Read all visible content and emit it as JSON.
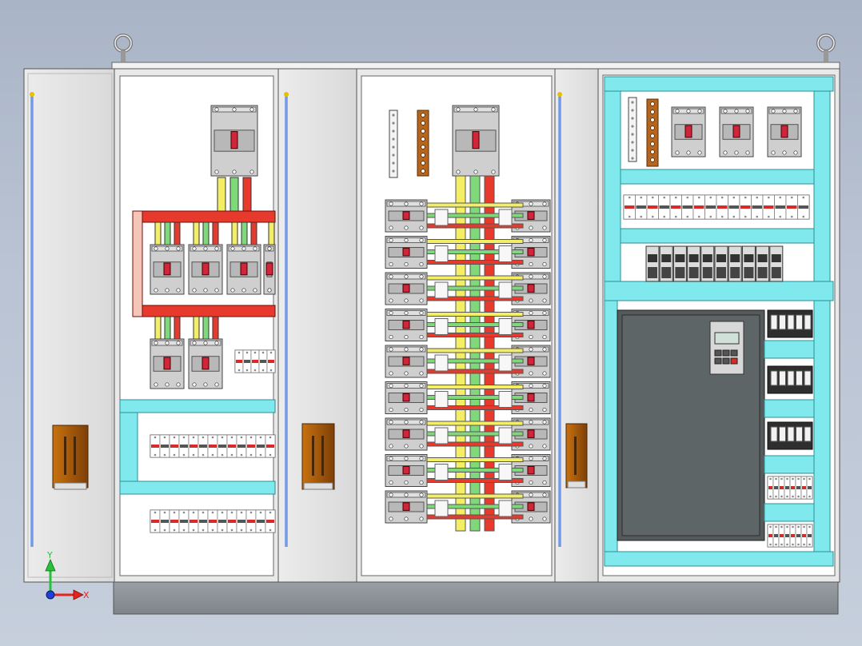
{
  "viewport": {
    "width": 1078,
    "height": 808
  },
  "colors": {
    "background": "#b9c3d3",
    "cabinet_frame": "#e6e6e6",
    "panel_white": "#ffffff",
    "busbar_red": "#e83a2c",
    "busbar_green": "#7fd87a",
    "busbar_yellow": "#f3ee64",
    "wire_duct_cyan": "#7fe9ee",
    "breaker_grey": "#cfcfcf",
    "handle_brown": "#a2580e",
    "copper": "#b5651d",
    "vfd_panel": "#555b5c",
    "axis_x": "#e4221f",
    "axis_y": "#28c23a",
    "axis_origin": "#1e40d8"
  },
  "cabinets": {
    "left_door": {
      "name": "door-left"
    },
    "panel_1": {
      "name": "cabinet-1",
      "breaker_groups": 2
    },
    "panel_2": {
      "name": "cabinet-2",
      "feeder_rows": 9
    },
    "panel_3": {
      "name": "cabinet-3",
      "terminal_rows": 2
    }
  },
  "axis_triad": {
    "x_label": "X",
    "y_label": "Y"
  }
}
